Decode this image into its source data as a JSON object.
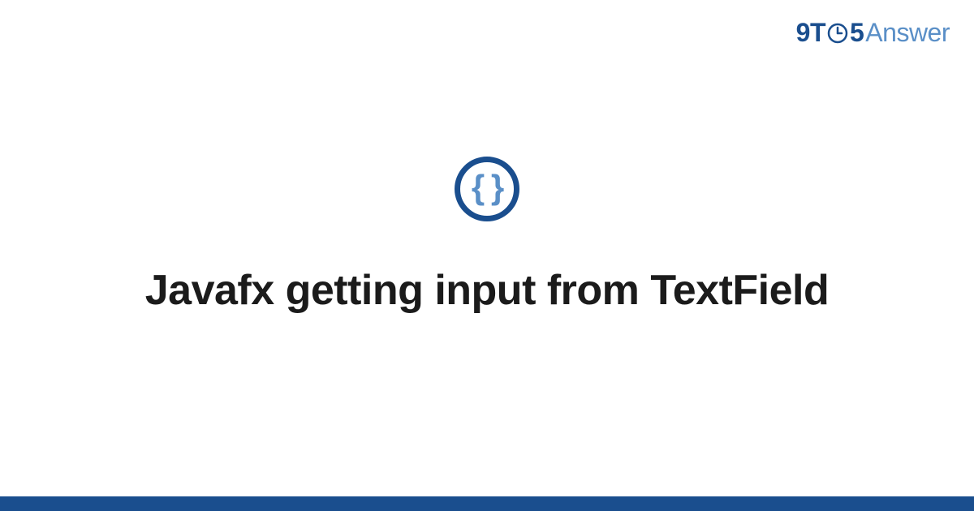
{
  "logo": {
    "part1": "9T",
    "part2": "5",
    "part3": "Answer"
  },
  "icon": {
    "braces": "{ }"
  },
  "title": "Javafx getting input from TextField",
  "colors": {
    "primary": "#1a4e8e",
    "secondary": "#5a8fc7"
  }
}
